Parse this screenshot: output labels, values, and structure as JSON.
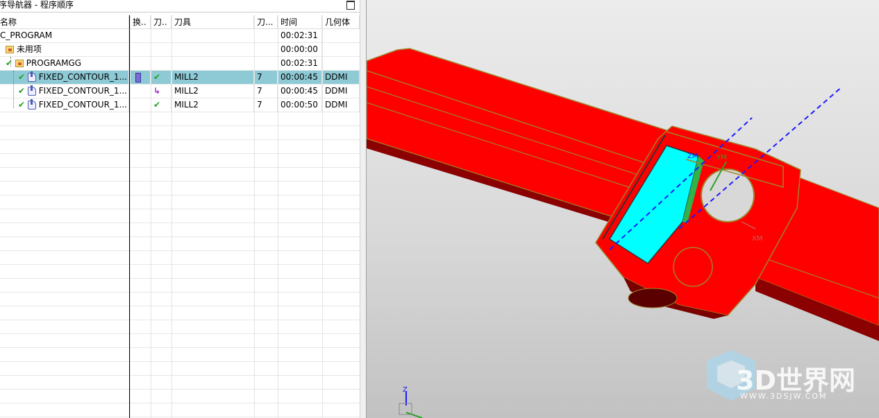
{
  "navigator": {
    "title": "序导航器 - 程序顺序",
    "columns": [
      "名称",
      "换..",
      "刀..",
      "刀具",
      "刀...",
      "时间",
      "几何体"
    ],
    "rows": [
      {
        "name": "C_PROGRAM",
        "tool": "",
        "num": "",
        "time": "00:02:31",
        "geom": ""
      },
      {
        "name": "未用项",
        "tool": "",
        "num": "",
        "time": "00:00:00",
        "geom": ""
      },
      {
        "name": "PROGRAMGG",
        "tool": "",
        "num": "",
        "time": "00:02:31",
        "geom": ""
      },
      {
        "name": "FIXED_CONTOUR_1...",
        "tool": "MILL2",
        "num": "7",
        "time": "00:00:45",
        "geom": "DDMI"
      },
      {
        "name": "FIXED_CONTOUR_1...",
        "tool": "MILL2",
        "num": "7",
        "time": "00:00:45",
        "geom": "DDMI"
      },
      {
        "name": "FIXED_CONTOUR_1...",
        "tool": "MILL2",
        "num": "7",
        "time": "00:00:50",
        "geom": "DDMI"
      }
    ]
  },
  "viewport": {
    "labels": {
      "ym": "YM",
      "xm": "XM",
      "zm": "ZM",
      "z_axis": "Z"
    },
    "watermark": {
      "brand": "3D世界网",
      "url": "WWW.3DSJW.COM"
    }
  },
  "colors": {
    "part_red": "#ff0000",
    "selected_row": "#8ecad6",
    "toolpath_cyan": "#00ffff",
    "check_green": "#1aa31a"
  }
}
